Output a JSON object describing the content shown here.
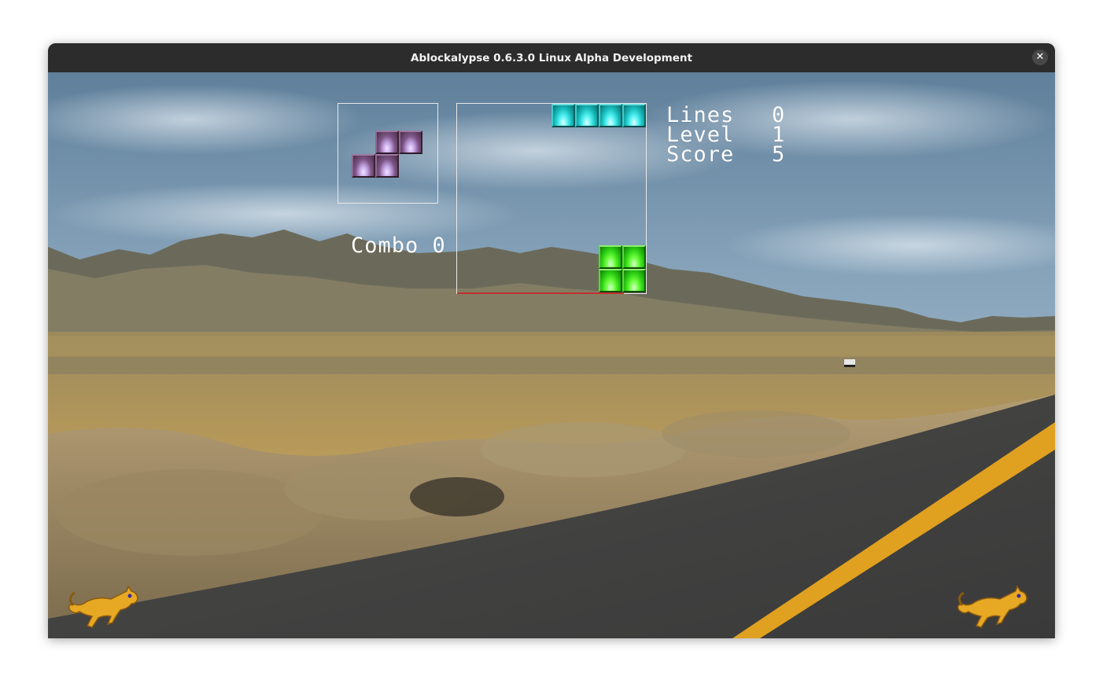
{
  "window": {
    "title": "Ablockalypse 0.6.3.0 Linux Alpha Development",
    "close_glyph": "✕"
  },
  "game": {
    "stats": {
      "lines_label": "Lines",
      "lines_value": "0",
      "level_label": "Level",
      "level_value": "1",
      "score_label": "Score",
      "score_value": "5"
    },
    "combo_label": "Combo 0",
    "next_piece": {
      "type": "S",
      "color": "purple"
    },
    "active_piece": {
      "type": "I",
      "color": "cyan",
      "orientation": "horizontal"
    },
    "stack": {
      "type": "O",
      "color": "green"
    },
    "background": "desert highway with mountains",
    "decorations": [
      "running-cat-left",
      "running-cat-right"
    ]
  },
  "colors": {
    "titlebar": "#2c2c2c",
    "panel_border": "#e8e8e8",
    "stack_line": "#c03030",
    "block_purple": "#8a6a92",
    "block_cyan": "#16b8b8",
    "block_green": "#2bcf12",
    "road_stripe": "#e0a020"
  }
}
